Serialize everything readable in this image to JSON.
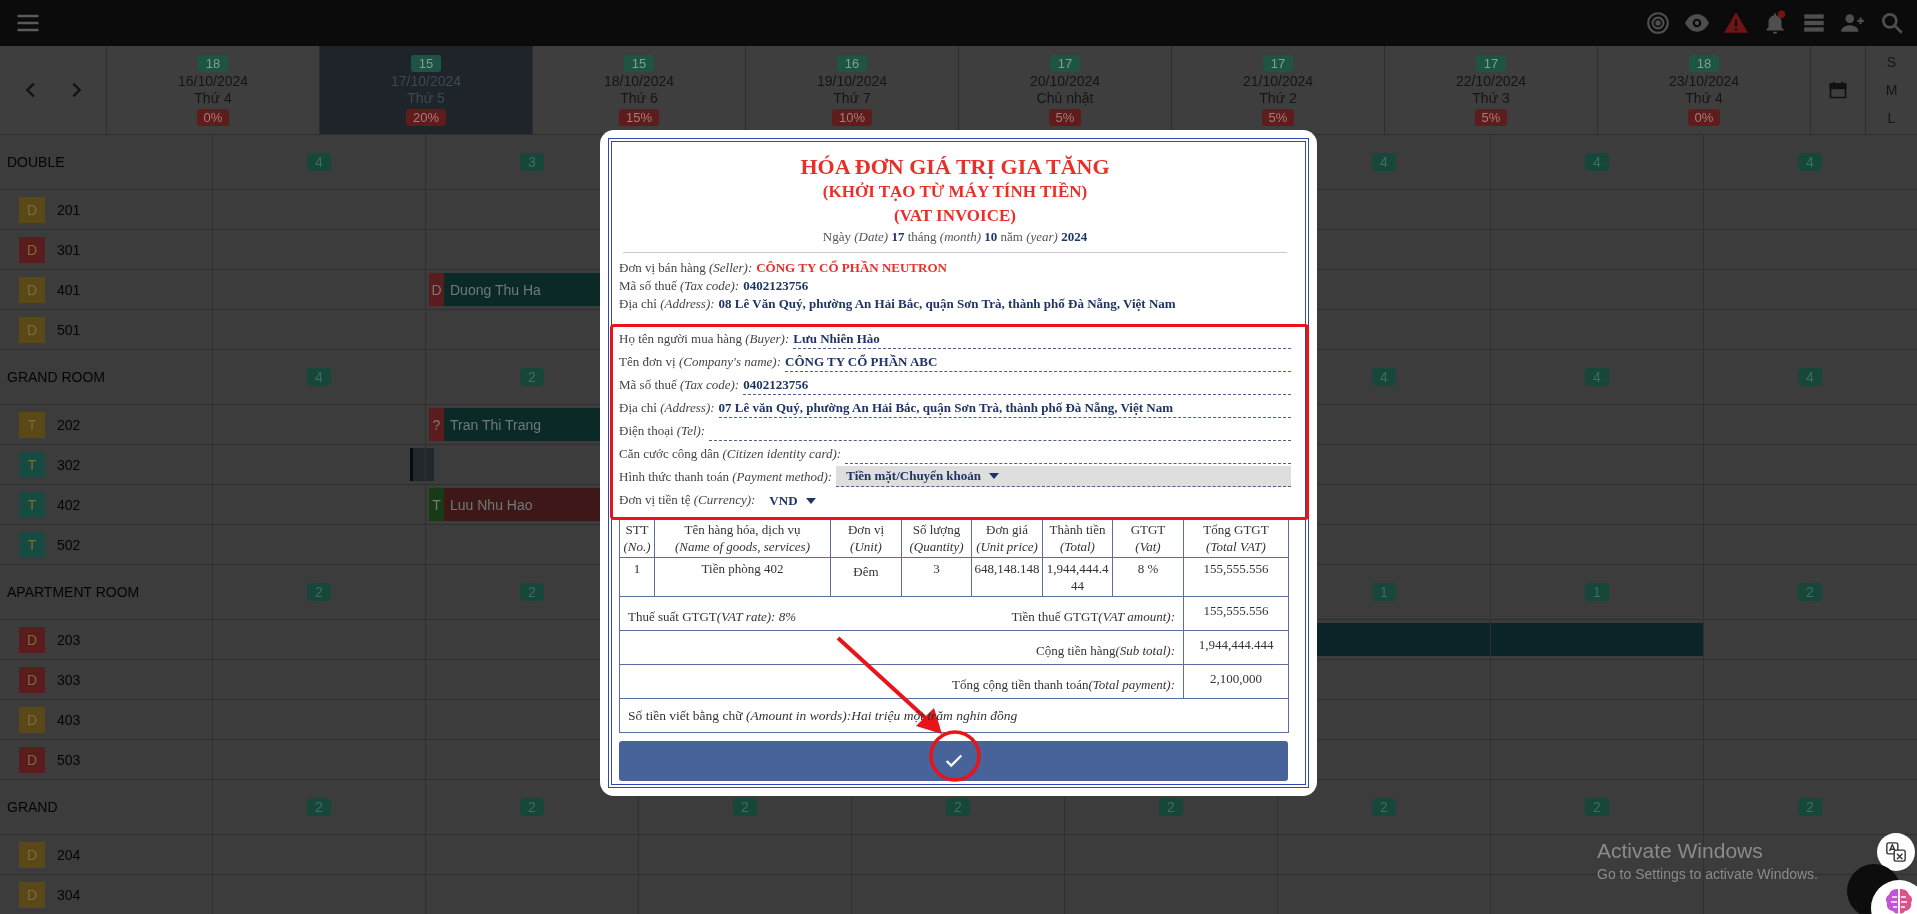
{
  "calendar": {
    "days": [
      {
        "count": "18",
        "date": "16/10/2024",
        "weekday": "Thứ 4",
        "rate": "0%",
        "selected": false
      },
      {
        "count": "15",
        "date": "17/10/2024",
        "weekday": "Thứ 5",
        "rate": "20%",
        "selected": true
      },
      {
        "count": "15",
        "date": "18/10/2024",
        "weekday": "Thứ 6",
        "rate": "15%",
        "selected": false
      },
      {
        "count": "16",
        "date": "19/10/2024",
        "weekday": "Thứ 7",
        "rate": "10%",
        "selected": false
      },
      {
        "count": "17",
        "date": "20/10/2024",
        "weekday": "Chủ nhật",
        "rate": "5%",
        "selected": false
      },
      {
        "count": "17",
        "date": "21/10/2024",
        "weekday": "Thứ 2",
        "rate": "5%",
        "selected": false
      },
      {
        "count": "17",
        "date": "22/10/2024",
        "weekday": "Thứ 3",
        "rate": "5%",
        "selected": false
      },
      {
        "count": "18",
        "date": "23/10/2024",
        "weekday": "Thứ 4",
        "rate": "0%",
        "selected": false
      }
    ],
    "sizes": [
      "S",
      "M",
      "L"
    ]
  },
  "room_groups": [
    {
      "name": "DOUBLE",
      "counts": [
        "4",
        "3"
      ],
      "counts_end": [
        "4",
        "4",
        "4"
      ],
      "rooms": [
        {
          "type": "D",
          "number": "201",
          "color": "#5a4816"
        },
        {
          "type": "D",
          "number": "301",
          "color": "#5a1c1c"
        },
        {
          "type": "D",
          "number": "401",
          "color": "#5a4816",
          "days": [
            {
              "kind": "free"
            },
            {
              "kind": "booking",
              "tag": {
                "text": "D",
                "color": "#5a1c1c"
              },
              "guest": "Duong Thu Ha",
              "color": "#0b2a27"
            }
          ]
        },
        {
          "type": "D",
          "number": "501",
          "color": "#5a4816"
        }
      ]
    },
    {
      "name": "GRAND ROOM",
      "counts": [
        "4",
        "2"
      ],
      "counts_end": [
        "4",
        "4",
        "4"
      ],
      "rooms": [
        {
          "type": "T",
          "number": "202",
          "color": "#5a4816",
          "days": [
            {
              "kind": "free"
            },
            {
              "kind": "booking",
              "tag": {
                "text": "?",
                "color": "#5a1c1c"
              },
              "guest": "Tran Thi Trang",
              "color": "#0b2a27"
            }
          ]
        },
        {
          "type": "T",
          "number": "302",
          "color": "#174a40",
          "days": [
            {
              "kind": "block",
              "color": "#22272c"
            }
          ]
        },
        {
          "type": "T",
          "number": "402",
          "color": "#174a40",
          "days": [
            {
              "kind": "free"
            },
            {
              "kind": "booking",
              "tag": {
                "text": "T",
                "color": "#173a17"
              },
              "guest": "Luu Nhu Hao",
              "color": "#3e1818"
            }
          ]
        },
        {
          "type": "T",
          "number": "502",
          "color": "#174a40"
        }
      ]
    },
    {
      "name": "APARTMENT ROOM",
      "counts": [
        "2",
        "2"
      ],
      "counts_end": [
        "1",
        "1",
        "2"
      ],
      "rooms": [
        {
          "type": "D",
          "number": "203",
          "color": "#5a1c1c",
          "days": [
            {
              "kind": "free"
            },
            {
              "kind": "free"
            },
            {
              "kind": "free"
            },
            {
              "kind": "free"
            },
            {
              "kind": "free"
            },
            {
              "kind": "stay",
              "color": "#0a2427"
            },
            {
              "kind": "stay",
              "color": "#0a2427"
            }
          ]
        },
        {
          "type": "D",
          "number": "303",
          "color": "#5a1c1c"
        },
        {
          "type": "D",
          "number": "403",
          "color": "#5a4816"
        },
        {
          "type": "D",
          "number": "503",
          "color": "#5a1c1c"
        }
      ]
    },
    {
      "name": "GRAND",
      "counts": [
        "2",
        "2",
        "2",
        "2",
        "2",
        "2",
        "2",
        "2"
      ],
      "rooms": [
        {
          "type": "D",
          "number": "204",
          "color": "#5a4816"
        },
        {
          "type": "D",
          "number": "304",
          "color": "#5a4816"
        }
      ]
    }
  ],
  "invoice": {
    "title": "HÓA ĐƠN GIÁ TRỊ GIA TĂNG",
    "subtitle": "(KHỞI TẠO TỪ MÁY TÍNH TIỀN)",
    "subtitle_en": "(VAT INVOICE)",
    "date_line": "Ngày  *(Date)* **17** tháng  *(month)* **10** năm  *(year)* **2024**",
    "seller": [
      {
        "kind": "company",
        "label": "Đơn vị bán hàng  *(Seller):*",
        "value": "CÔNG TY CỔ PHẦN NEUTRON"
      },
      {
        "kind": "plain",
        "label": "Mã số thuế  *(Tax code):*",
        "value": "0402123756"
      },
      {
        "kind": "plain",
        "label": "Địa chỉ  *(Address):*",
        "value": "08 Lê Văn Quý, phường An Hải Bắc, quận Sơn Trà, thành phố Đà Nẵng, Việt Nam"
      }
    ],
    "buyer": [
      {
        "kind": "text",
        "label": "Họ tên người mua hàng  *(Buyer):*",
        "value": "Lưu Nhiên Hào"
      },
      {
        "kind": "text",
        "label": "Tên đơn vị  *(Company's name):*",
        "value": "CÔNG TY CỔ PHẦN ABC"
      },
      {
        "kind": "text",
        "label": "Mã số thuế  *(Tax code):*",
        "value": "0402123756"
      },
      {
        "kind": "text",
        "label": "Địa chỉ  *(Address):*",
        "value": "07 Lê văn Quý, phường An Hải Bắc, quận Sơn Trà, thành phố Đà Nẵng, Việt Nam"
      },
      {
        "kind": "text",
        "label": "Điện thoại  *(Tel):*"
      },
      {
        "kind": "text",
        "label": "Căn cước công dân  *(Citizen identity card):*"
      },
      {
        "kind": "select",
        "label": "Hình thức thanh toán  *(Payment method):*",
        "value": "Tiền mặt/Chuyển khoản"
      },
      {
        "kind": "inline_select",
        "label": "Đơn vị tiền tệ  *(Currency):*",
        "value": "VND"
      }
    ],
    "table": {
      "columns": [
        {
          "title": "STT",
          "title_en": "(No.)"
        },
        {
          "title": "Tên hàng hóa, dịch vụ",
          "title_en": "(Name of goods, services)"
        },
        {
          "title": "Đơn vị",
          "title_en": "(Unit)"
        },
        {
          "title": "Số lượng",
          "title_en": "(Quantity)"
        },
        {
          "title": "Đơn giá",
          "title_en": "(Unit price)"
        },
        {
          "title": "Thành tiền",
          "title_en": "(Total)"
        },
        {
          "title": "GTGT",
          "title_en": "(Vat)"
        },
        {
          "title": "Tổng GTGT",
          "title_en": "(Total VAT)"
        }
      ],
      "rows": [
        [
          "1",
          "Tiền phòng 402",
          "Đêm",
          "3",
          "648,148.148",
          "1,944,444.444",
          "8 %",
          "155,555.556"
        ]
      ]
    },
    "totals": [
      {
        "note": "Thuế suất GTGT",
        "note_en": "(VAT rate): 8%",
        "label": "Tiền thuế GTGT",
        "label_en": "(VAT amount):",
        "value": "155,555.556"
      },
      {
        "label": "Cộng tiền hàng",
        "label_en": "(Sub total):",
        "value": "1,944,444.444"
      },
      {
        "label": "Tổng cộng tiền thanh toán",
        "label_en": "(Total payment):",
        "value": "2,100,000"
      }
    ],
    "amount_in_words": "Số tiền viết bằng chữ *(Amount in words):Hai triệu một trăm nghin đồng*"
  },
  "os_notice": {
    "title": "Activate Windows",
    "text": "Go to Settings to activate Windows."
  }
}
